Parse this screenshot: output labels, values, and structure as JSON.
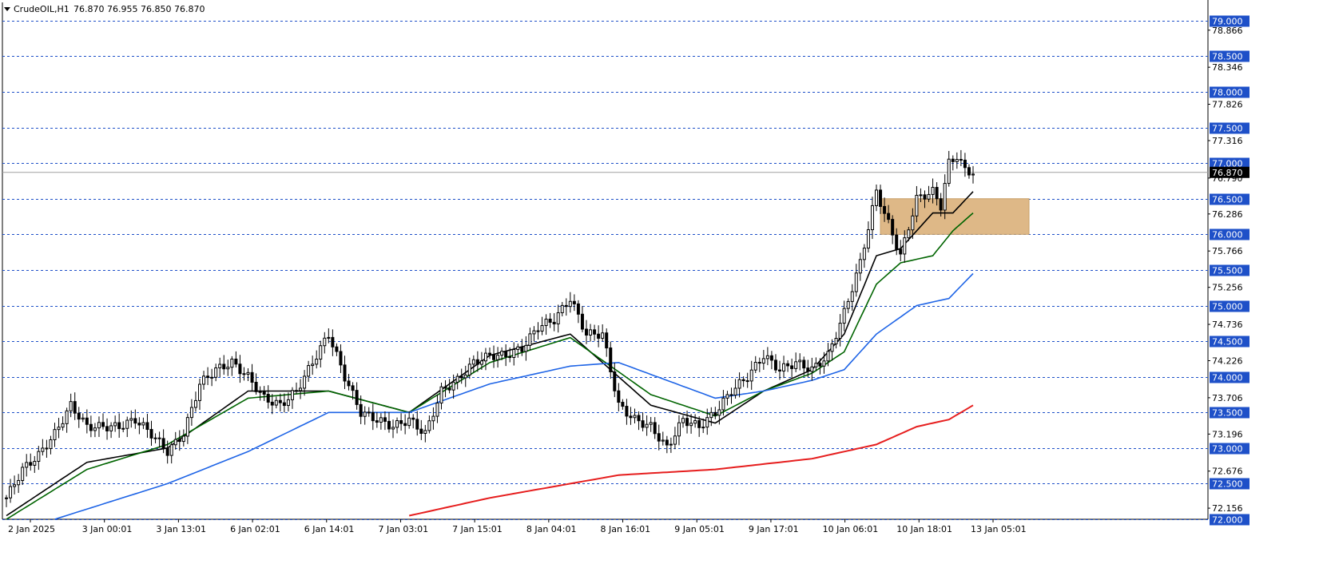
{
  "header": {
    "symbol_label": "CrudeOIL,H1",
    "ohlc": "76.870 76.955 76.850 76.870"
  },
  "colors": {
    "background": "#ffffff",
    "grid": "#1e50c8",
    "level_tag_bg": "#1e50c8",
    "level_tag_text": "#ffffff",
    "candle": "#000000",
    "ma_fast": "#000000",
    "ma_mid": "#006400",
    "ma_slow": "#1e64e6",
    "ma_long": "#e61e1e",
    "zone": "#deb887",
    "price_line": "#a0a0a0",
    "price_tag_bg": "#000000"
  },
  "chart_data": {
    "type": "candlestick",
    "title": "CrudeOIL,H1",
    "ylim": [
      72.0,
      79.2
    ],
    "grid": "dashed horizontal at round levels",
    "current_price": "76.870",
    "y_level_labels": [
      "79.000",
      "78.500",
      "78.000",
      "77.500",
      "77.000",
      "76.500",
      "76.000",
      "75.500",
      "75.000",
      "74.500",
      "74.000",
      "73.500",
      "73.000",
      "72.500",
      "72.000"
    ],
    "y_tick_labels": [
      "78.866",
      "78.346",
      "77.826",
      "77.316",
      "76.790",
      "76.286",
      "75.766",
      "75.256",
      "74.736",
      "74.226",
      "73.706",
      "73.196",
      "72.676",
      "72.156"
    ],
    "x_tick_labels": [
      "2 Jan 2025",
      "3 Jan 00:01",
      "3 Jan 13:01",
      "6 Jan 02:01",
      "6 Jan 14:01",
      "7 Jan 03:01",
      "7 Jan 15:01",
      "8 Jan 04:01",
      "8 Jan 16:01",
      "9 Jan 05:01",
      "9 Jan 17:01",
      "10 Jan 06:01",
      "10 Jan 18:01",
      "13 Jan 05:01"
    ],
    "zone": {
      "x_from": "10 Jan 06:01",
      "x_to": "13 Jan 05:01",
      "price_high": 76.5,
      "price_low": 76.0
    },
    "close_path": [
      [
        0,
        72.3
      ],
      [
        4,
        72.7
      ],
      [
        8,
        72.9
      ],
      [
        12,
        73.2
      ],
      [
        16,
        73.6
      ],
      [
        20,
        73.3
      ],
      [
        24,
        73.3
      ],
      [
        28,
        73.3
      ],
      [
        32,
        73.4
      ],
      [
        36,
        73.2
      ],
      [
        40,
        72.95
      ],
      [
        44,
        73.2
      ],
      [
        48,
        73.9
      ],
      [
        52,
        74.1
      ],
      [
        56,
        74.2
      ],
      [
        60,
        74.0
      ],
      [
        64,
        73.7
      ],
      [
        68,
        73.6
      ],
      [
        72,
        73.8
      ],
      [
        76,
        74.2
      ],
      [
        80,
        74.6
      ],
      [
        84,
        74.0
      ],
      [
        88,
        73.5
      ],
      [
        92,
        73.4
      ],
      [
        96,
        73.3
      ],
      [
        100,
        73.4
      ],
      [
        104,
        73.2
      ],
      [
        108,
        73.8
      ],
      [
        112,
        73.95
      ],
      [
        116,
        74.2
      ],
      [
        120,
        74.3
      ],
      [
        124,
        74.3
      ],
      [
        128,
        74.4
      ],
      [
        132,
        74.7
      ],
      [
        136,
        74.8
      ],
      [
        140,
        75.1
      ],
      [
        144,
        74.6
      ],
      [
        148,
        74.6
      ],
      [
        152,
        73.6
      ],
      [
        156,
        73.4
      ],
      [
        160,
        73.3
      ],
      [
        164,
        73.0
      ],
      [
        168,
        73.4
      ],
      [
        172,
        73.3
      ],
      [
        176,
        73.5
      ],
      [
        180,
        73.8
      ],
      [
        184,
        74.0
      ],
      [
        188,
        74.3
      ],
      [
        192,
        74.1
      ],
      [
        196,
        74.2
      ],
      [
        200,
        74.1
      ],
      [
        204,
        74.3
      ],
      [
        208,
        74.9
      ],
      [
        212,
        75.6
      ],
      [
        216,
        76.6
      ],
      [
        220,
        76.0
      ],
      [
        222,
        75.7
      ],
      [
        226,
        76.5
      ],
      [
        230,
        76.6
      ],
      [
        232,
        76.4
      ],
      [
        234,
        77.0
      ],
      [
        236,
        77.1
      ],
      [
        238,
        76.9
      ],
      [
        240,
        76.87
      ]
    ],
    "series": [
      {
        "values": [
          [
            0,
            72.05
          ],
          [
            20,
            72.8
          ],
          [
            40,
            73.0
          ],
          [
            60,
            73.8
          ],
          [
            80,
            73.8
          ],
          [
            100,
            73.5
          ],
          [
            120,
            74.3
          ],
          [
            140,
            74.6
          ],
          [
            160,
            73.6
          ],
          [
            176,
            73.35
          ],
          [
            188,
            73.8
          ],
          [
            200,
            74.1
          ],
          [
            208,
            74.6
          ],
          [
            216,
            75.7
          ],
          [
            222,
            75.8
          ],
          [
            230,
            76.3
          ],
          [
            235,
            76.3
          ],
          [
            240,
            76.6
          ]
        ]
      },
      {
        "values": [
          [
            0,
            72.0
          ],
          [
            20,
            72.7
          ],
          [
            40,
            73.05
          ],
          [
            60,
            73.7
          ],
          [
            80,
            73.8
          ],
          [
            100,
            73.5
          ],
          [
            120,
            74.2
          ],
          [
            140,
            74.55
          ],
          [
            160,
            73.75
          ],
          [
            176,
            73.45
          ],
          [
            188,
            73.8
          ],
          [
            200,
            74.05
          ],
          [
            208,
            74.35
          ],
          [
            216,
            75.3
          ],
          [
            222,
            75.6
          ],
          [
            230,
            75.7
          ],
          [
            235,
            76.05
          ],
          [
            240,
            76.3
          ]
        ]
      },
      {
        "values": [
          [
            12,
            72.0
          ],
          [
            40,
            72.5
          ],
          [
            60,
            72.95
          ],
          [
            80,
            73.5
          ],
          [
            100,
            73.5
          ],
          [
            120,
            73.9
          ],
          [
            140,
            74.15
          ],
          [
            152,
            74.2
          ],
          [
            176,
            73.7
          ],
          [
            188,
            73.8
          ],
          [
            200,
            73.95
          ],
          [
            208,
            74.1
          ],
          [
            216,
            74.6
          ],
          [
            226,
            75.0
          ],
          [
            234,
            75.1
          ],
          [
            240,
            75.45
          ]
        ]
      },
      {
        "values": [
          [
            100,
            72.05
          ],
          [
            120,
            72.3
          ],
          [
            140,
            72.5
          ],
          [
            152,
            72.62
          ],
          [
            176,
            72.7
          ],
          [
            200,
            72.85
          ],
          [
            208,
            72.95
          ],
          [
            216,
            73.05
          ],
          [
            226,
            73.3
          ],
          [
            234,
            73.4
          ],
          [
            240,
            73.6
          ]
        ]
      }
    ]
  }
}
